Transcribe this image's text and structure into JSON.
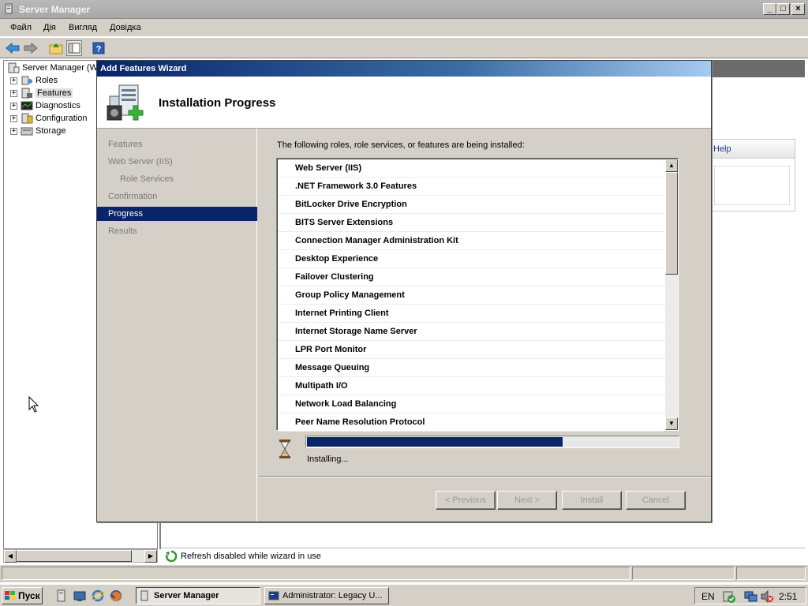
{
  "window": {
    "title": "Server Manager"
  },
  "menu": [
    "Файл",
    "Дія",
    "Вигляд",
    "Довідка"
  ],
  "tree": {
    "root": "Server Manager (W",
    "items": [
      "Roles",
      "Features",
      "Diagnostics",
      "Configuration",
      "Storage"
    ],
    "selected": "Features"
  },
  "help_panel": {
    "link": "Help"
  },
  "status": {
    "text": "Refresh disabled while wizard in use"
  },
  "wizard": {
    "title": "Add Features Wizard",
    "heading": "Installation Progress",
    "nav": [
      {
        "label": "Features",
        "sub": false,
        "active": false
      },
      {
        "label": "Web Server (IIS)",
        "sub": false,
        "active": false
      },
      {
        "label": "Role Services",
        "sub": true,
        "active": false
      },
      {
        "label": "Confirmation",
        "sub": false,
        "active": false
      },
      {
        "label": "Progress",
        "sub": false,
        "active": true
      },
      {
        "label": "Results",
        "sub": false,
        "active": false
      }
    ],
    "intro": "The following roles, role services, or features are being installed:",
    "items": [
      "Web Server (IIS)",
      ".NET Framework 3.0 Features",
      "BitLocker Drive Encryption",
      "BITS Server Extensions",
      "Connection Manager Administration Kit",
      "Desktop Experience",
      "Failover Clustering",
      "Group Policy Management",
      "Internet Printing Client",
      "Internet Storage Name Server",
      "LPR Port Monitor",
      "Message Queuing",
      "Multipath I/O",
      "Network Load Balancing",
      "Peer Name Resolution Protocol"
    ],
    "progress_fraction": 0.69,
    "progress_text": "Installing...",
    "buttons": {
      "previous": "< Previous",
      "next": "Next >",
      "install": "Install",
      "cancel": "Cancel"
    }
  },
  "taskbar": {
    "start": "Пуск",
    "tasks": [
      {
        "label": "Server Manager",
        "active": true
      },
      {
        "label": "Administrator: Legacy U...",
        "active": false
      }
    ],
    "language": "EN",
    "clock": "2:51"
  },
  "colors": {
    "accent": "#0a246a",
    "face": "#d4d0c8"
  }
}
